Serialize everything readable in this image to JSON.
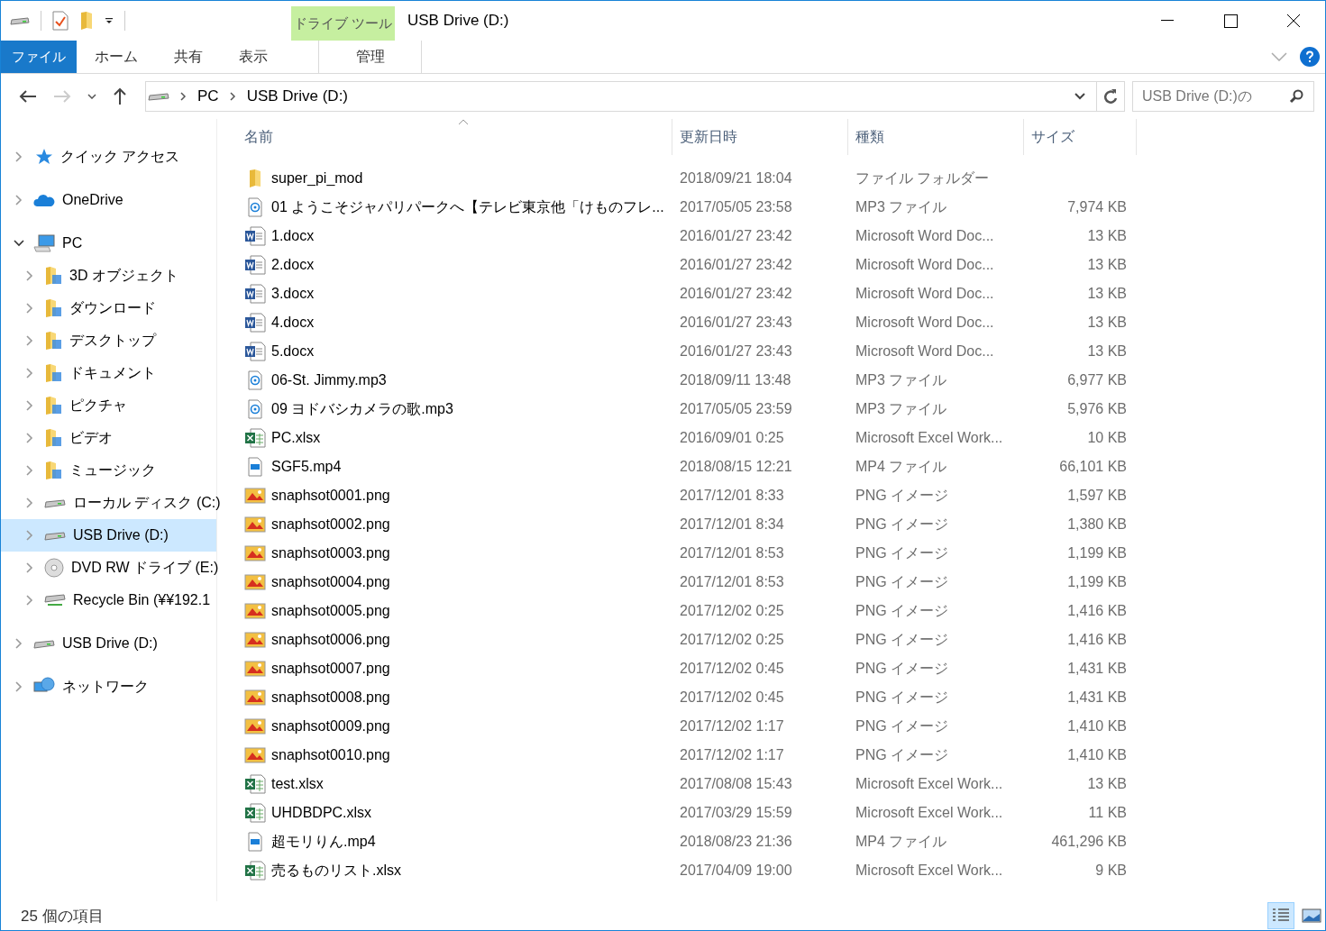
{
  "window": {
    "title": "USB Drive (D:)"
  },
  "ribbon": {
    "context_group": "ドライブ ツール",
    "tabs": [
      {
        "label": "ファイル",
        "kind": "file",
        "selected": false
      },
      {
        "label": "ホーム",
        "kind": "normal",
        "selected": false
      },
      {
        "label": "共有",
        "kind": "normal",
        "selected": false
      },
      {
        "label": "表示",
        "kind": "normal",
        "selected": false
      },
      {
        "label": "管理",
        "kind": "context",
        "selected": false
      }
    ]
  },
  "address": {
    "path": [
      "PC",
      "USB Drive (D:)"
    ]
  },
  "search": {
    "placeholder": "USB Drive (D:)の"
  },
  "sidebar": {
    "items": [
      {
        "label": "クイック アクセス",
        "kind": "star",
        "expanded": false,
        "selected": false
      },
      {
        "label": "OneDrive",
        "kind": "cloud",
        "expanded": false,
        "selected": false
      },
      {
        "label": "PC",
        "kind": "computer",
        "expanded": true,
        "selected": false,
        "children": [
          {
            "label": "3D オブジェクト",
            "kind": "folder",
            "expanded": false,
            "selected": false
          },
          {
            "label": "ダウンロード",
            "kind": "folder",
            "expanded": false,
            "selected": false
          },
          {
            "label": "デスクトップ",
            "kind": "folder",
            "expanded": false,
            "selected": false
          },
          {
            "label": "ドキュメント",
            "kind": "folder",
            "expanded": false,
            "selected": false
          },
          {
            "label": "ピクチャ",
            "kind": "folder",
            "expanded": false,
            "selected": false
          },
          {
            "label": "ビデオ",
            "kind": "folder",
            "expanded": false,
            "selected": false
          },
          {
            "label": "ミュージック",
            "kind": "folder",
            "expanded": false,
            "selected": false
          },
          {
            "label": "ローカル ディスク (C:)",
            "kind": "drive",
            "expanded": false,
            "selected": false
          },
          {
            "label": "USB Drive (D:)",
            "kind": "drive",
            "expanded": false,
            "selected": true
          },
          {
            "label": "DVD RW ドライブ (E:)",
            "kind": "disc",
            "expanded": false,
            "selected": false
          },
          {
            "label": "Recycle Bin (¥¥192.1",
            "kind": "netdrive",
            "expanded": false,
            "selected": false
          }
        ]
      },
      {
        "label": "USB Drive (D:)",
        "kind": "drive",
        "expanded": false,
        "selected": false
      },
      {
        "label": "ネットワーク",
        "kind": "network",
        "expanded": false,
        "selected": false
      }
    ]
  },
  "table": {
    "columns": [
      {
        "label": "名前",
        "sorted": true
      },
      {
        "label": "更新日時",
        "sorted": false
      },
      {
        "label": "種類",
        "sorted": false
      },
      {
        "label": "サイズ",
        "sorted": false
      }
    ],
    "rows": [
      {
        "name": "super_pi_mod",
        "date": "2018/09/21 18:04",
        "type": "ファイル フォルダー",
        "kind": "folder"
      },
      {
        "name": "01  ようこそジャパリパークへ【テレビ東京他「けものフレ...",
        "date": "2017/05/05 23:58",
        "type": "MP3 ファイル",
        "size": "7,974 KB",
        "kind": "audio"
      },
      {
        "name": "1.docx",
        "date": "2016/01/27 23:42",
        "type": "Microsoft Word Doc...",
        "size": "13 KB",
        "kind": "word"
      },
      {
        "name": "2.docx",
        "date": "2016/01/27 23:42",
        "type": "Microsoft Word Doc...",
        "size": "13 KB",
        "kind": "word"
      },
      {
        "name": "3.docx",
        "date": "2016/01/27 23:42",
        "type": "Microsoft Word Doc...",
        "size": "13 KB",
        "kind": "word"
      },
      {
        "name": "4.docx",
        "date": "2016/01/27 23:43",
        "type": "Microsoft Word Doc...",
        "size": "13 KB",
        "kind": "word"
      },
      {
        "name": "5.docx",
        "date": "2016/01/27 23:43",
        "type": "Microsoft Word Doc...",
        "size": "13 KB",
        "kind": "word"
      },
      {
        "name": "06-St. Jimmy.mp3",
        "date": "2018/09/11 13:48",
        "type": "MP3 ファイル",
        "size": "6,977 KB",
        "kind": "audio"
      },
      {
        "name": "09  ヨドバシカメラの歌.mp3",
        "date": "2017/05/05 23:59",
        "type": "MP3 ファイル",
        "size": "5,976 KB",
        "kind": "audio"
      },
      {
        "name": "PC.xlsx",
        "date": "2016/09/01 0:25",
        "type": "Microsoft Excel Work...",
        "size": "10 KB",
        "kind": "excel"
      },
      {
        "name": "SGF5.mp4",
        "date": "2018/08/15 12:21",
        "type": "MP4 ファイル",
        "size": "66,101 KB",
        "kind": "video"
      },
      {
        "name": "snaphsot0001.png",
        "date": "2017/12/01 8:33",
        "type": "PNG イメージ",
        "size": "1,597 KB",
        "kind": "image"
      },
      {
        "name": "snaphsot0002.png",
        "date": "2017/12/01 8:34",
        "type": "PNG イメージ",
        "size": "1,380 KB",
        "kind": "image"
      },
      {
        "name": "snaphsot0003.png",
        "date": "2017/12/01 8:53",
        "type": "PNG イメージ",
        "size": "1,199 KB",
        "kind": "image"
      },
      {
        "name": "snaphsot0004.png",
        "date": "2017/12/01 8:53",
        "type": "PNG イメージ",
        "size": "1,199 KB",
        "kind": "image"
      },
      {
        "name": "snaphsot0005.png",
        "date": "2017/12/02 0:25",
        "type": "PNG イメージ",
        "size": "1,416 KB",
        "kind": "image"
      },
      {
        "name": "snaphsot0006.png",
        "date": "2017/12/02 0:25",
        "type": "PNG イメージ",
        "size": "1,416 KB",
        "kind": "image"
      },
      {
        "name": "snaphsot0007.png",
        "date": "2017/12/02 0:45",
        "type": "PNG イメージ",
        "size": "1,431 KB",
        "kind": "image"
      },
      {
        "name": "snaphsot0008.png",
        "date": "2017/12/02 0:45",
        "type": "PNG イメージ",
        "size": "1,431 KB",
        "kind": "image"
      },
      {
        "name": "snaphsot0009.png",
        "date": "2017/12/02 1:17",
        "type": "PNG イメージ",
        "size": "1,410 KB",
        "kind": "image"
      },
      {
        "name": "snaphsot0010.png",
        "date": "2017/12/02 1:17",
        "type": "PNG イメージ",
        "size": "1,410 KB",
        "kind": "image"
      },
      {
        "name": "test.xlsx",
        "date": "2017/08/08 15:43",
        "type": "Microsoft Excel Work...",
        "size": "13 KB",
        "kind": "excel"
      },
      {
        "name": "UHDBDPC.xlsx",
        "date": "2017/03/29 15:59",
        "type": "Microsoft Excel Work...",
        "size": "11 KB",
        "kind": "excel"
      },
      {
        "name": "超モリりん.mp4",
        "date": "2018/08/23 21:36",
        "type": "MP4 ファイル",
        "size": "461,296 KB",
        "kind": "video"
      },
      {
        "name": "売るものリスト.xlsx",
        "date": "2017/04/09 19:00",
        "type": "Microsoft Excel Work...",
        "size": "9 KB",
        "kind": "excel"
      }
    ]
  },
  "status_bar": {
    "text": "25 個の項目",
    "views": [
      {
        "kind": "details",
        "selected": true
      },
      {
        "kind": "large-icons",
        "selected": false
      }
    ]
  }
}
